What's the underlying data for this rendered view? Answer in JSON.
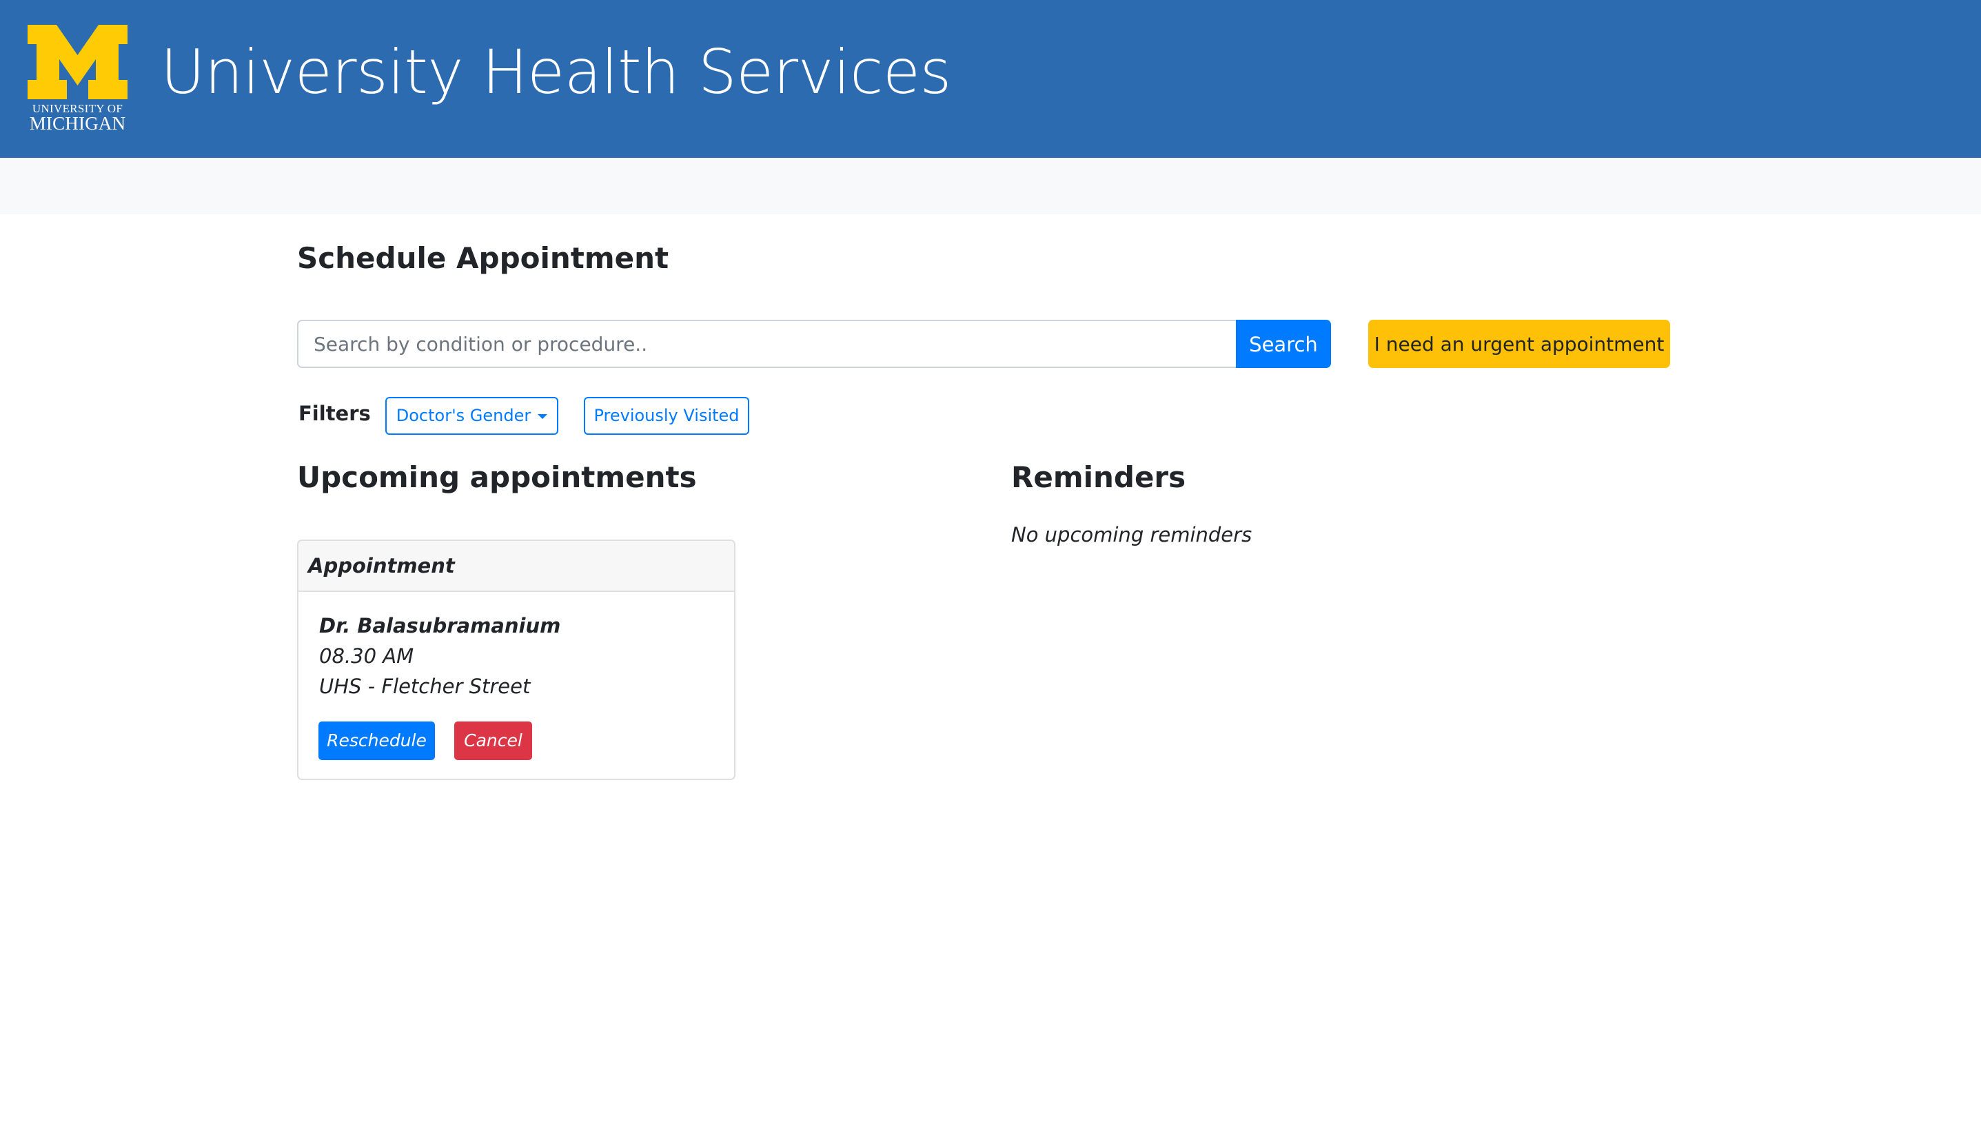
{
  "header": {
    "logo": {
      "letter": "M",
      "line1": "UNIVERSITY OF",
      "line2": "MICHIGAN",
      "color": "#FFCB05"
    },
    "title": "University Health Services",
    "background": "#2D6BB1"
  },
  "main": {
    "title": "Schedule Appointment",
    "search": {
      "placeholder": "Search by condition or procedure..",
      "value": "",
      "button_label": "Search"
    },
    "urgent_button_label": "I need an urgent appointment",
    "filters": {
      "label": "Filters",
      "items": [
        {
          "label": "Doctor's Gender",
          "icon": "caret-down-icon"
        },
        {
          "label": "Previously Visited"
        }
      ]
    }
  },
  "upcoming": {
    "title": "Upcoming appointments",
    "appointments": [
      {
        "header": "Appointment",
        "doctor": "Dr. Balasubramanium",
        "time": "08.30 AM",
        "location": "UHS - Fletcher Street",
        "reschedule_label": "Reschedule",
        "cancel_label": "Cancel"
      }
    ]
  },
  "reminders": {
    "title": "Reminders",
    "empty_text": "No upcoming reminders"
  },
  "colors": {
    "primary": "#007BFF",
    "warning": "#FFC107",
    "danger": "#DC3545",
    "subbar": "#F8F9FA"
  }
}
